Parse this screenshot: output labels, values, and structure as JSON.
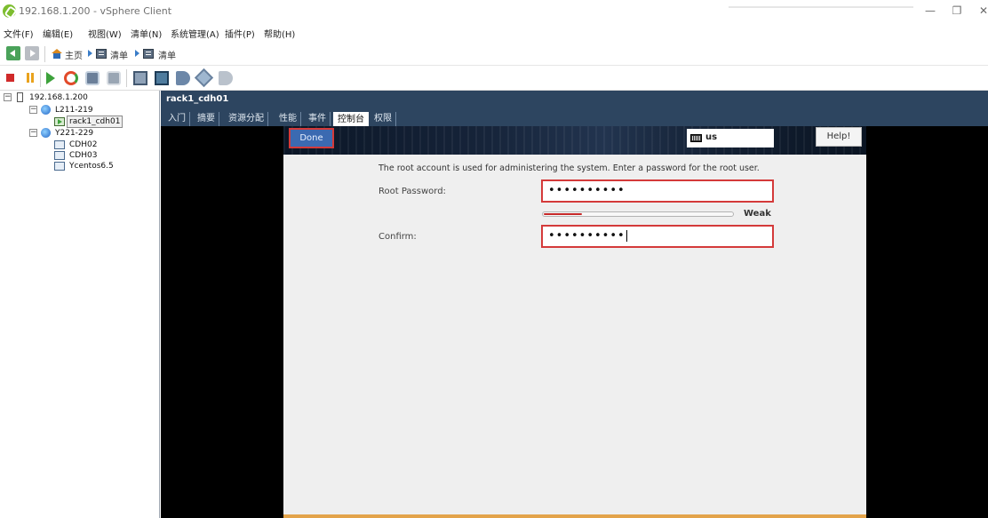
{
  "window": {
    "title": "192.168.1.200 - vSphere Client",
    "minimize": "—",
    "maximize": "❐",
    "close": "✕"
  },
  "menu": [
    "文件(F)",
    "编辑(E)",
    "视图(W)",
    "清单(N)",
    "系统管理(A)",
    "插件(P)",
    "帮助(H)"
  ],
  "breadcrumb": {
    "home": "主页",
    "item1": "清单",
    "item2": "清单"
  },
  "tree": {
    "host": "192.168.1.200",
    "dc1": "L211-219",
    "vm_selected": "rack1_cdh01",
    "dc2": "Y221-229",
    "vms": [
      "CDH02",
      "CDH03",
      "Ycentos6.5"
    ]
  },
  "content": {
    "vm_title": "rack1_cdh01",
    "tabs": [
      "入门",
      "摘要",
      "资源分配",
      "性能",
      "事件",
      "控制台",
      "权限"
    ],
    "active_tab": "控制台"
  },
  "installer": {
    "done_label": "Done",
    "keyboard_layout": "us",
    "help_label": "Help!",
    "instructions": "The root account is used for administering the system.  Enter a password for the root user.",
    "root_password_label": "Root Password:",
    "root_password_value": "••••••••••",
    "confirm_label": "Confirm:",
    "confirm_value": "••••••••••",
    "strength_label": "Weak",
    "strength_level": 0.2
  },
  "colors": {
    "header_bg": "#2d4560",
    "highlight_border": "#d43a3a",
    "done_button": "#3b6ab1",
    "strength_weak": "#c62828",
    "installer_bottom": "#e3a34a"
  }
}
